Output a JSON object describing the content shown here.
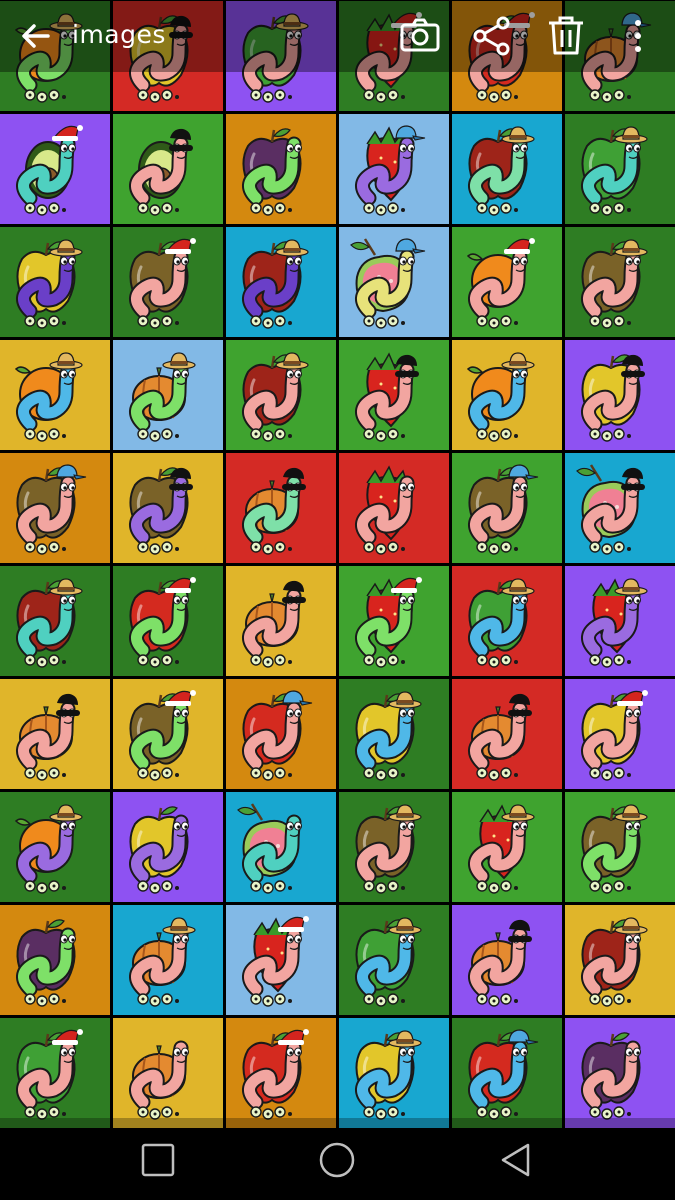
{
  "app_bar": {
    "title": "images",
    "actions": [
      "camera-icon",
      "share-icon",
      "trash-icon",
      "more-vertical-icon"
    ]
  },
  "nav_bar": {
    "buttons": [
      "recents-square-icon",
      "home-circle-icon",
      "back-triangle-icon"
    ]
  },
  "palette": {
    "dg": "#2e7d23",
    "lg": "#3fa32f",
    "sk": "#82b9e6",
    "ye": "#e0b52a",
    "or": "#d4890f",
    "rd": "#d42a25",
    "pu": "#8e52f2",
    "cy": "#18a7d0"
  },
  "fruit_colors": {
    "apple_green": "#3fa035",
    "apple_yellow": "#e2c62a",
    "apple_red": "#d42a1f",
    "apple_brown": "#7a6228",
    "apple_darkred": "#9e2419",
    "orange": "#f08a1c",
    "strawberry": "#d8241e",
    "avocado": "#5b8d2a",
    "plum": "#5a2e62",
    "pumpkin": "#e48a30",
    "guava": "#f08094"
  },
  "grid": {
    "rows": [
      {
        "tiles": [
          {
            "bg": "dg",
            "fruit": "apple_green",
            "worm": "#f2a5a0",
            "hat": "santa"
          },
          {
            "bg": "sk",
            "fruit": "apple_yellow",
            "worm": "#f2a5a0",
            "hat": "cowboy"
          },
          {
            "bg": "ye",
            "fruit": "apple_yellow",
            "worm": "#f2a5a0",
            "hat": "cowboy"
          },
          {
            "bg": "or",
            "fruit": "apple_red",
            "worm": "#f2a5a0",
            "hat": "mask"
          },
          {
            "bg": "dg",
            "fruit": "apple_brown",
            "worm": "#9a6be0",
            "hat": "none"
          },
          {
            "bg": "dg",
            "fruit": "apple_green",
            "worm": "#f2a5a0",
            "hat": "santa"
          }
        ]
      },
      {
        "tiles": [
          {
            "bg": "dg",
            "fruit": "orange",
            "worm": "#7ee068",
            "hat": "cowboy"
          },
          {
            "bg": "rd",
            "fruit": "apple_yellow",
            "worm": "#f2a5a0",
            "hat": "mask"
          },
          {
            "bg": "pu",
            "fruit": "apple_green",
            "worm": "#f2a5a0",
            "hat": "cowboy"
          },
          {
            "bg": "dg",
            "fruit": "strawberry",
            "worm": "#f2a5a0",
            "hat": "santa"
          },
          {
            "bg": "or",
            "fruit": "apple_red",
            "worm": "#f2a5a0",
            "hat": "santa"
          },
          {
            "bg": "dg",
            "fruit": "pumpkin",
            "worm": "#f2a5a0",
            "hat": "cap"
          }
        ]
      },
      {
        "tiles": [
          {
            "bg": "pu",
            "fruit": "avocado",
            "worm": "#4fd0c0",
            "hat": "santa"
          },
          {
            "bg": "lg",
            "fruit": "avocado",
            "worm": "#f2a5a0",
            "hat": "mask"
          },
          {
            "bg": "or",
            "fruit": "plum",
            "worm": "#7ee068",
            "hat": "none"
          },
          {
            "bg": "sk",
            "fruit": "strawberry",
            "worm": "#9a6be0",
            "hat": "cap"
          },
          {
            "bg": "cy",
            "fruit": "apple_darkred",
            "worm": "#7ee0a8",
            "hat": "cowboy"
          },
          {
            "bg": "dg",
            "fruit": "apple_green",
            "worm": "#4fd0c0",
            "hat": "cowboy"
          }
        ]
      },
      {
        "tiles": [
          {
            "bg": "dg",
            "fruit": "apple_yellow",
            "worm": "#6a3fc8",
            "hat": "cowboy"
          },
          {
            "bg": "dg",
            "fruit": "apple_brown",
            "worm": "#f2a5a0",
            "hat": "santa"
          },
          {
            "bg": "cy",
            "fruit": "apple_darkred",
            "worm": "#6a3fc8",
            "hat": "cowboy"
          },
          {
            "bg": "sk",
            "fruit": "guava",
            "worm": "#e7e27a",
            "hat": "cap"
          },
          {
            "bg": "lg",
            "fruit": "orange",
            "worm": "#f2a5a0",
            "hat": "santa"
          },
          {
            "bg": "dg",
            "fruit": "apple_brown",
            "worm": "#f2a5a0",
            "hat": "cowboy"
          }
        ]
      },
      {
        "tiles": [
          {
            "bg": "ye",
            "fruit": "orange",
            "worm": "#4fb8e8",
            "hat": "cowboy"
          },
          {
            "bg": "sk",
            "fruit": "pumpkin",
            "worm": "#7ee068",
            "hat": "cowboy"
          },
          {
            "bg": "lg",
            "fruit": "apple_darkred",
            "worm": "#f2a5a0",
            "hat": "cowboy"
          },
          {
            "bg": "lg",
            "fruit": "strawberry",
            "worm": "#f2a5a0",
            "hat": "mask"
          },
          {
            "bg": "ye",
            "fruit": "orange",
            "worm": "#4fb8e8",
            "hat": "cowboy"
          },
          {
            "bg": "pu",
            "fruit": "apple_yellow",
            "worm": "#f2a5a0",
            "hat": "mask"
          }
        ]
      },
      {
        "tiles": [
          {
            "bg": "or",
            "fruit": "apple_brown",
            "worm": "#f2a5a0",
            "hat": "cap"
          },
          {
            "bg": "ye",
            "fruit": "apple_brown",
            "worm": "#9a6be0",
            "hat": "mask"
          },
          {
            "bg": "rd",
            "fruit": "pumpkin",
            "worm": "#7ee0a8",
            "hat": "mask"
          },
          {
            "bg": "rd",
            "fruit": "strawberry",
            "worm": "#f2a5a0",
            "hat": "none"
          },
          {
            "bg": "lg",
            "fruit": "apple_brown",
            "worm": "#f2a5a0",
            "hat": "cap"
          },
          {
            "bg": "cy",
            "fruit": "guava",
            "worm": "#f2a5a0",
            "hat": "mask"
          }
        ]
      },
      {
        "tiles": [
          {
            "bg": "dg",
            "fruit": "apple_darkred",
            "worm": "#4fd0c0",
            "hat": "cowboy"
          },
          {
            "bg": "dg",
            "fruit": "apple_red",
            "worm": "#7ee068",
            "hat": "santa"
          },
          {
            "bg": "ye",
            "fruit": "pumpkin",
            "worm": "#f2a5a0",
            "hat": "mask"
          },
          {
            "bg": "lg",
            "fruit": "strawberry",
            "worm": "#7ee068",
            "hat": "santa"
          },
          {
            "bg": "rd",
            "fruit": "apple_green",
            "worm": "#4fb8e8",
            "hat": "cowboy"
          },
          {
            "bg": "pu",
            "fruit": "strawberry",
            "worm": "#9a6be0",
            "hat": "cowboy"
          }
        ]
      },
      {
        "tiles": [
          {
            "bg": "ye",
            "fruit": "pumpkin",
            "worm": "#f2a5a0",
            "hat": "mask"
          },
          {
            "bg": "ye",
            "fruit": "apple_brown",
            "worm": "#7ee068",
            "hat": "santa"
          },
          {
            "bg": "or",
            "fruit": "apple_red",
            "worm": "#f2a5a0",
            "hat": "cap"
          },
          {
            "bg": "dg",
            "fruit": "apple_yellow",
            "worm": "#4fb8e8",
            "hat": "cowboy"
          },
          {
            "bg": "rd",
            "fruit": "pumpkin",
            "worm": "#f2a5a0",
            "hat": "mask"
          },
          {
            "bg": "pu",
            "fruit": "apple_yellow",
            "worm": "#f2a5a0",
            "hat": "santa"
          }
        ]
      },
      {
        "tiles": [
          {
            "bg": "dg",
            "fruit": "orange",
            "worm": "#9a6be0",
            "hat": "cowboy"
          },
          {
            "bg": "pu",
            "fruit": "apple_yellow",
            "worm": "#9a6be0",
            "hat": "none"
          },
          {
            "bg": "cy",
            "fruit": "guava",
            "worm": "#4fd0c0",
            "hat": "none"
          },
          {
            "bg": "dg",
            "fruit": "apple_brown",
            "worm": "#f2a5a0",
            "hat": "cowboy"
          },
          {
            "bg": "lg",
            "fruit": "strawberry",
            "worm": "#f2a5a0",
            "hat": "cowboy"
          },
          {
            "bg": "lg",
            "fruit": "apple_brown",
            "worm": "#7ee068",
            "hat": "cowboy"
          }
        ]
      },
      {
        "tiles": [
          {
            "bg": "or",
            "fruit": "plum",
            "worm": "#7ee068",
            "hat": "none"
          },
          {
            "bg": "cy",
            "fruit": "pumpkin",
            "worm": "#f2a5a0",
            "hat": "cowboy"
          },
          {
            "bg": "sk",
            "fruit": "strawberry",
            "worm": "#f2a5a0",
            "hat": "santa"
          },
          {
            "bg": "dg",
            "fruit": "apple_green",
            "worm": "#4fb8e8",
            "hat": "cowboy"
          },
          {
            "bg": "pu",
            "fruit": "pumpkin",
            "worm": "#f2a5a0",
            "hat": "mask"
          },
          {
            "bg": "ye",
            "fruit": "apple_darkred",
            "worm": "#f2a5a0",
            "hat": "cowboy"
          }
        ]
      },
      {
        "tiles": [
          {
            "bg": "dg",
            "fruit": "apple_green",
            "worm": "#f2a5a0",
            "hat": "santa"
          },
          {
            "bg": "ye",
            "fruit": "pumpkin",
            "worm": "#f2a5a0",
            "hat": "none"
          },
          {
            "bg": "or",
            "fruit": "apple_red",
            "worm": "#f2a5a0",
            "hat": "santa"
          },
          {
            "bg": "cy",
            "fruit": "apple_yellow",
            "worm": "#4fb8e8",
            "hat": "cowboy"
          },
          {
            "bg": "dg",
            "fruit": "apple_red",
            "worm": "#4fb8e8",
            "hat": "cap"
          },
          {
            "bg": "pu",
            "fruit": "plum",
            "worm": "#f2a5a0",
            "hat": "none"
          }
        ]
      }
    ]
  }
}
